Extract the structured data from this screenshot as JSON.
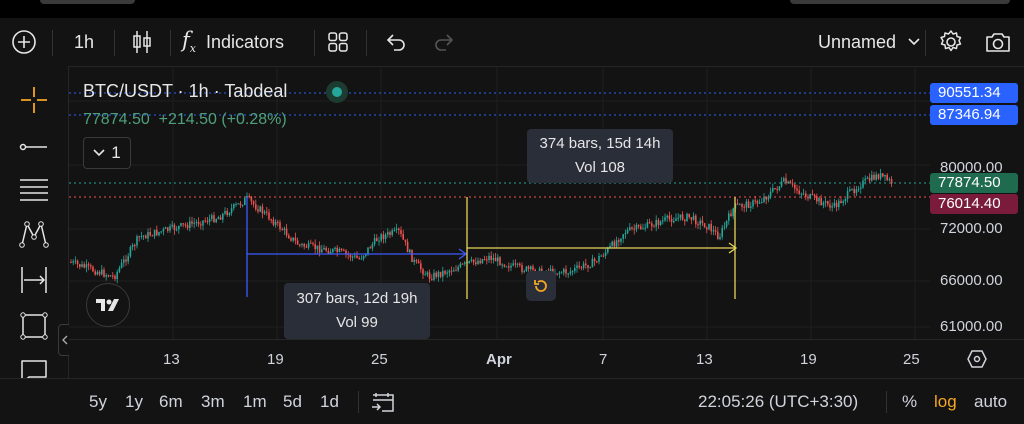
{
  "toolbar": {
    "interval": "1h",
    "indicators_label": "Indicators",
    "layout_name": "Unnamed"
  },
  "legend": {
    "symbol_title": "BTC/USDT · 1h · Tabdeal",
    "last_price": "77874.50",
    "change": "+214.50 (+0.28%)",
    "collapse_count": "1"
  },
  "price_axis": {
    "labels": [
      "80000.00",
      "72000.00",
      "66000.00",
      "61000.00"
    ],
    "badges": [
      {
        "value": "90551.34",
        "color": "#2962ff"
      },
      {
        "value": "87346.94",
        "color": "#2962ff"
      },
      {
        "value": "77874.50",
        "color": "#1e6b4f"
      },
      {
        "value": "76014.40",
        "color": "#7a1b3b"
      }
    ]
  },
  "time_axis": {
    "labels": [
      "13",
      "19",
      "25",
      "Apr",
      "7",
      "13",
      "19",
      "25"
    ]
  },
  "measurements": [
    {
      "bars": "307 bars, 12d 19h",
      "vol": "Vol 99",
      "color": "#3d5afe"
    },
    {
      "bars": "374 bars, 15d 14h",
      "vol": "Vol 108",
      "color": "#e8d55a"
    }
  ],
  "bottom_bar": {
    "ranges": [
      "5y",
      "1y",
      "6m",
      "3m",
      "1m",
      "5d",
      "1d"
    ],
    "clock": "22:05:26 (UTC+3:30)",
    "percent_label": "%",
    "log_label": "log",
    "auto_label": "auto"
  },
  "colors": {
    "up": "#26a69a",
    "down": "#ef5350",
    "accent": "#f5a623",
    "log_active": "#f5a623"
  },
  "icons": {
    "add": "plus-circle-icon",
    "candles": "candles-icon",
    "indicators": "fx-icon",
    "layouts": "grid-icon",
    "undo": "undo-icon",
    "redo": "redo-icon",
    "settings": "gear-icon",
    "snapshot": "camera-icon"
  }
}
